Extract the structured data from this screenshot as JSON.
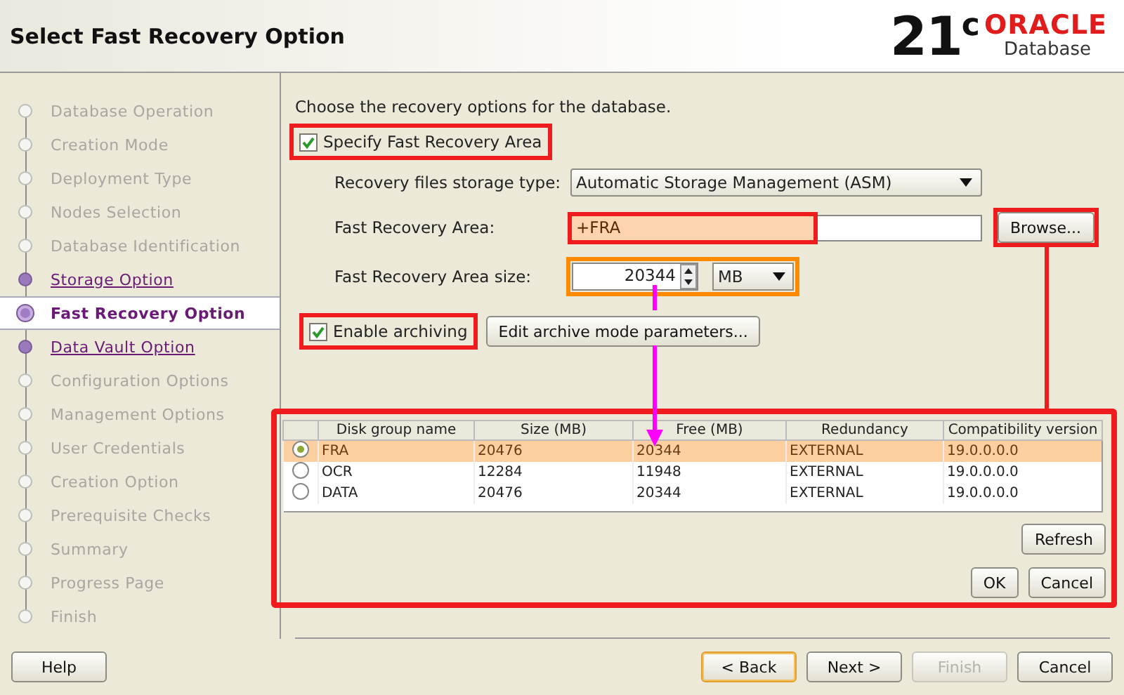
{
  "header": {
    "title": "Select Fast Recovery Option",
    "logo_version": "21",
    "logo_version_sup": "c",
    "logo_brand": "ORACLE",
    "logo_product": "Database"
  },
  "steps": [
    {
      "label": "Database Operation",
      "enabled": false,
      "selected": false
    },
    {
      "label": "Creation Mode",
      "enabled": false,
      "selected": false
    },
    {
      "label": "Deployment Type",
      "enabled": false,
      "selected": false
    },
    {
      "label": "Nodes Selection",
      "enabled": false,
      "selected": false
    },
    {
      "label": "Database Identification",
      "enabled": false,
      "selected": false
    },
    {
      "label": "Storage Option",
      "enabled": true,
      "selected": false
    },
    {
      "label": "Fast Recovery Option",
      "enabled": true,
      "selected": true
    },
    {
      "label": "Data Vault Option",
      "enabled": true,
      "selected": false
    },
    {
      "label": "Configuration Options",
      "enabled": false,
      "selected": false
    },
    {
      "label": "Management Options",
      "enabled": false,
      "selected": false
    },
    {
      "label": "User Credentials",
      "enabled": false,
      "selected": false
    },
    {
      "label": "Creation Option",
      "enabled": false,
      "selected": false
    },
    {
      "label": "Prerequisite Checks",
      "enabled": false,
      "selected": false
    },
    {
      "label": "Summary",
      "enabled": false,
      "selected": false
    },
    {
      "label": "Progress Page",
      "enabled": false,
      "selected": false
    },
    {
      "label": "Finish",
      "enabled": false,
      "selected": false
    }
  ],
  "content": {
    "instruction": "Choose the recovery options for the database.",
    "specify_fra": {
      "label": "Specify Fast Recovery Area",
      "checked": true,
      "highlighted": true
    },
    "storage_type": {
      "label": "Recovery files storage type:",
      "value": "Automatic Storage Management (ASM)"
    },
    "fra": {
      "label": "Fast Recovery Area:",
      "value": "+FRA",
      "highlighted": true
    },
    "browse": {
      "label": "Browse...",
      "highlighted": true
    },
    "fra_size": {
      "label": "Fast Recovery Area size:",
      "value": "20344",
      "unit": "MB",
      "highlighted": true
    },
    "archiving": {
      "label": "Enable archiving",
      "checked": true,
      "highlighted": true
    },
    "archive_params_button": "Edit archive mode parameters..."
  },
  "dialog": {
    "highlighted": true,
    "columns": [
      "Disk group name",
      "Size (MB)",
      "Free (MB)",
      "Redundancy",
      "Compatibility version"
    ],
    "rows": [
      {
        "selected": true,
        "cells": [
          "FRA",
          "20476",
          "20344",
          "EXTERNAL",
          "19.0.0.0.0"
        ]
      },
      {
        "selected": false,
        "cells": [
          "OCR",
          "12284",
          "11948",
          "EXTERNAL",
          "19.0.0.0.0"
        ]
      },
      {
        "selected": false,
        "cells": [
          "DATA",
          "20476",
          "20344",
          "EXTERNAL",
          "19.0.0.0.0"
        ]
      }
    ],
    "refresh_button": "Refresh",
    "ok_button": "OK",
    "cancel_button": "Cancel"
  },
  "footer": [
    {
      "label": "Help",
      "kind": "left",
      "focused": false,
      "disabled": false
    },
    {
      "label": "< Back",
      "kind": "right",
      "focused": true,
      "disabled": false
    },
    {
      "label": "Next >",
      "kind": "right",
      "focused": false,
      "disabled": false
    },
    {
      "label": "Finish",
      "kind": "right",
      "focused": false,
      "disabled": true
    },
    {
      "label": "Cancel",
      "kind": "right",
      "focused": false,
      "disabled": false
    }
  ]
}
